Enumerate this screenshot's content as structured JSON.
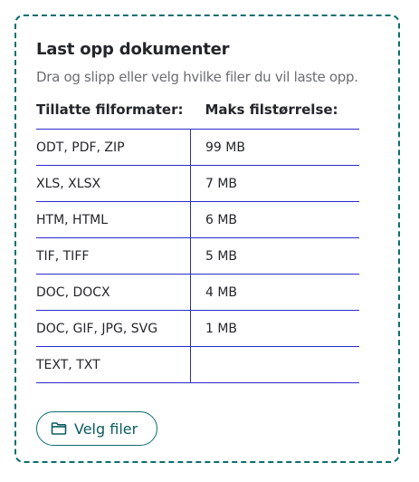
{
  "upload": {
    "title": "Last opp dokumenter",
    "subtitle": "Dra og slipp eller velg hvilke filer du vil laste opp.",
    "button_label": "Velg filer",
    "button_icon": "folder-icon"
  },
  "table": {
    "headers": [
      "Tillatte filformater:",
      "Maks filstørrelse:"
    ],
    "rows": [
      {
        "formats": "ODT, PDF, ZIP",
        "max_size": "99 MB"
      },
      {
        "formats": "XLS, XLSX",
        "max_size": "7 MB"
      },
      {
        "formats": "HTM, HTML",
        "max_size": "6 MB"
      },
      {
        "formats": "TIF, TIFF",
        "max_size": "5 MB"
      },
      {
        "formats": "DOC, DOCX",
        "max_size": "4 MB"
      },
      {
        "formats": "DOC, GIF, JPG, SVG",
        "max_size": "1 MB"
      },
      {
        "formats": "TEXT, TXT",
        "max_size": ""
      }
    ]
  },
  "colors": {
    "accent": "#0b6e6e",
    "table_border": "#2b2bc8",
    "muted_text": "#6a6d72"
  }
}
